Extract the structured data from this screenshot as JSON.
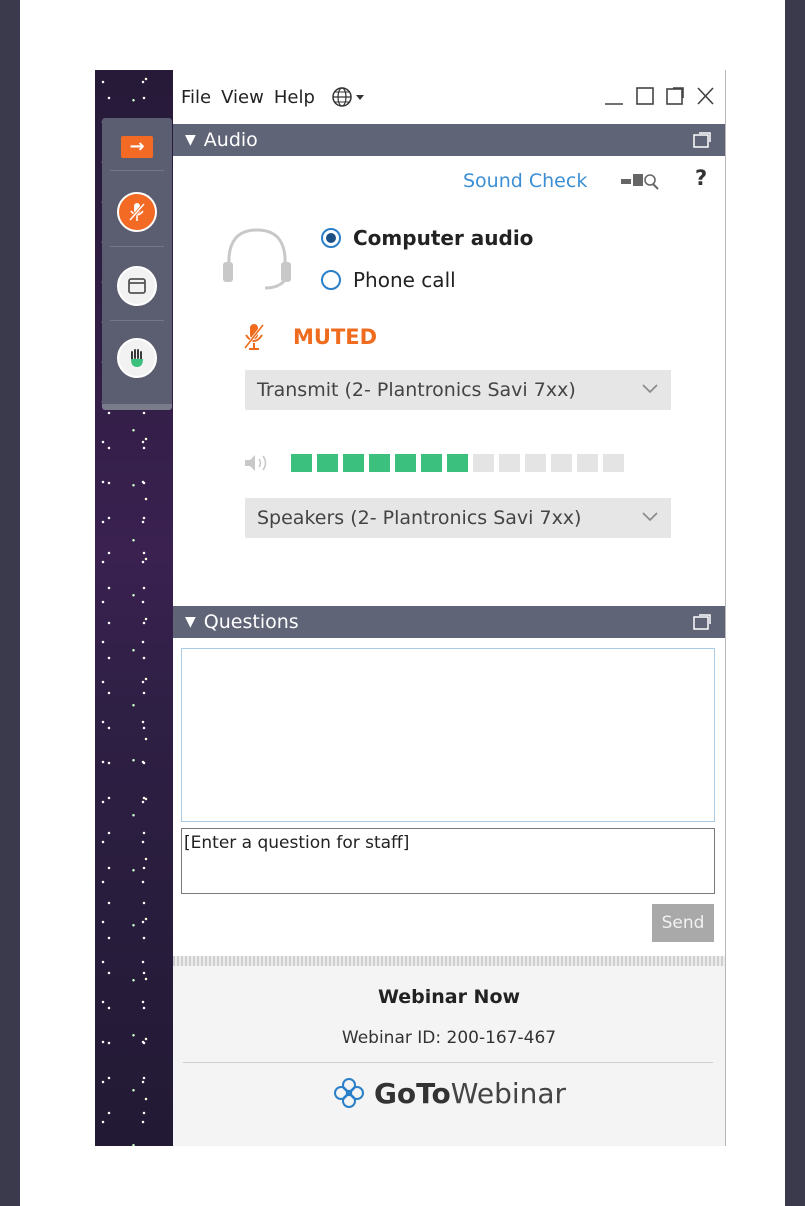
{
  "menubar": {
    "items": [
      "File",
      "View",
      "Help"
    ]
  },
  "audio_panel": {
    "title": "Audio",
    "sound_check": "Sound Check",
    "help": "?",
    "options": {
      "computer_audio": "Computer audio",
      "phone_call": "Phone call"
    },
    "selected_option": "Computer audio",
    "mute_status": "MUTED",
    "transmit_device": "Transmit (2- Plantronics Savi 7xx)",
    "speaker_device": "Speakers (2- Plantronics Savi 7xx)",
    "volume_level_bars": 7,
    "volume_total_bars": 13
  },
  "questions_panel": {
    "title": "Questions",
    "input_value": "[Enter a question for staff]",
    "send_label": "Send"
  },
  "footer": {
    "webinar_title": "Webinar Now",
    "webinar_id": "Webinar ID: 200-167-467",
    "logo_goto": "GoTo",
    "logo_webinar": "Webinar"
  },
  "colors": {
    "accent_orange": "#f26a24",
    "panel_header": "#5f6477",
    "link_blue": "#3c8fd4",
    "level_green": "#3cc07e",
    "level_empty": "#e4e4e4"
  }
}
